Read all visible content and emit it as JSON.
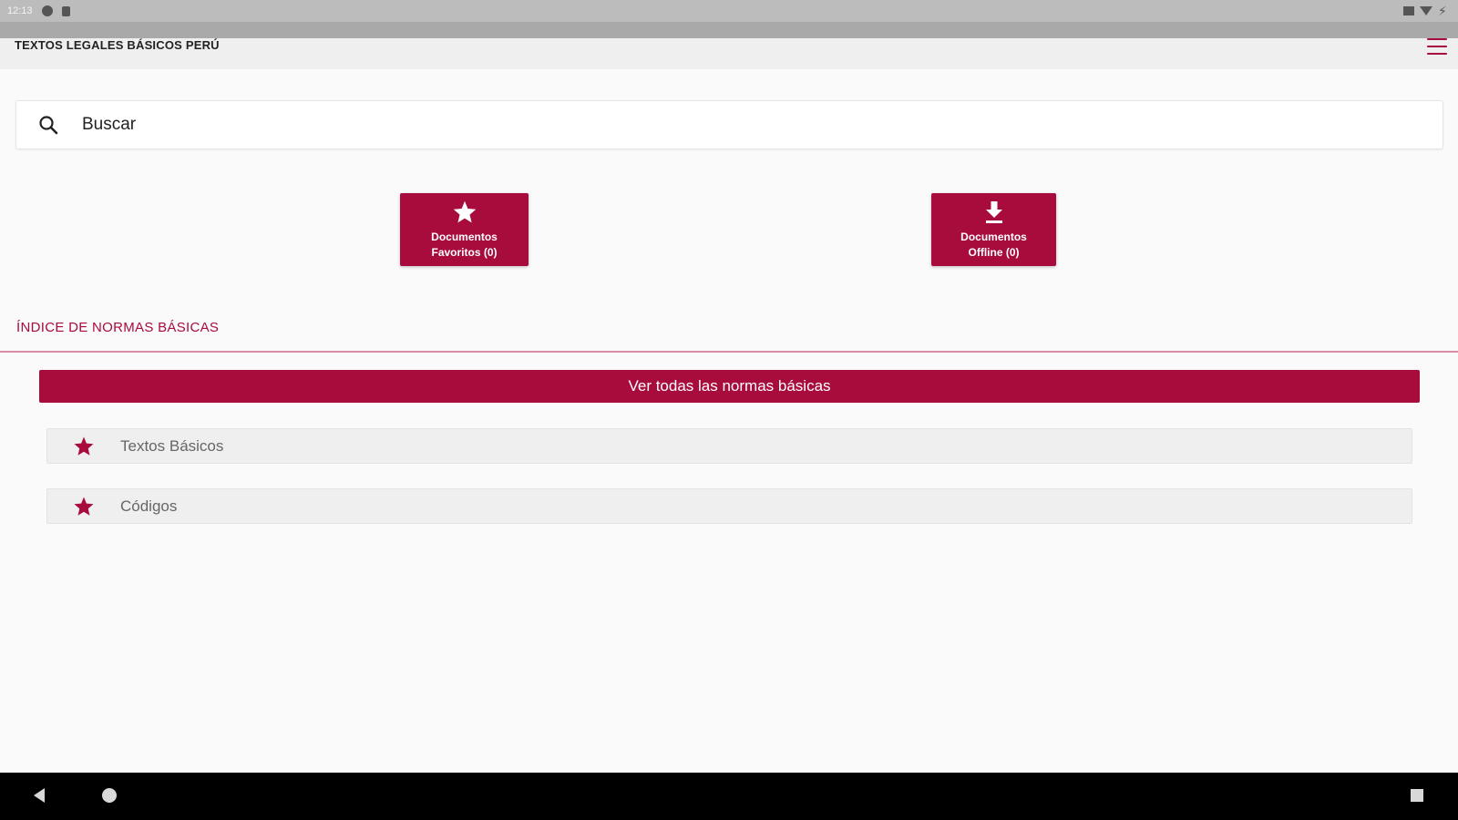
{
  "status_bar": {
    "time": "12:13",
    "icons": [
      "sync-icon",
      "lock-icon",
      "cast-icon",
      "wifi-icon",
      "battery-icon"
    ]
  },
  "app_bar": {
    "title": "TEXTOS LEGALES BÁSICOS PERÚ",
    "menu_icon": "hamburger-menu-icon"
  },
  "search": {
    "placeholder": "Buscar",
    "icon": "search-icon"
  },
  "quick_actions": [
    {
      "icon": "star-icon",
      "label_line1": "Documentos",
      "label_line2": "Favoritos (0)"
    },
    {
      "icon": "download-icon",
      "label_line1": "Documentos",
      "label_line2": "Offline (0)"
    }
  ],
  "section": {
    "title": "ÍNDICE DE NORMAS BÁSICAS",
    "view_all_label": "Ver todas las normas básicas"
  },
  "list": [
    {
      "icon": "star-icon",
      "label": "Textos Básicos"
    },
    {
      "icon": "star-icon",
      "label": "Códigos"
    }
  ],
  "colors": {
    "accent": "#a80c3c",
    "background": "#fafafa",
    "list_item_bg": "#efefef"
  }
}
